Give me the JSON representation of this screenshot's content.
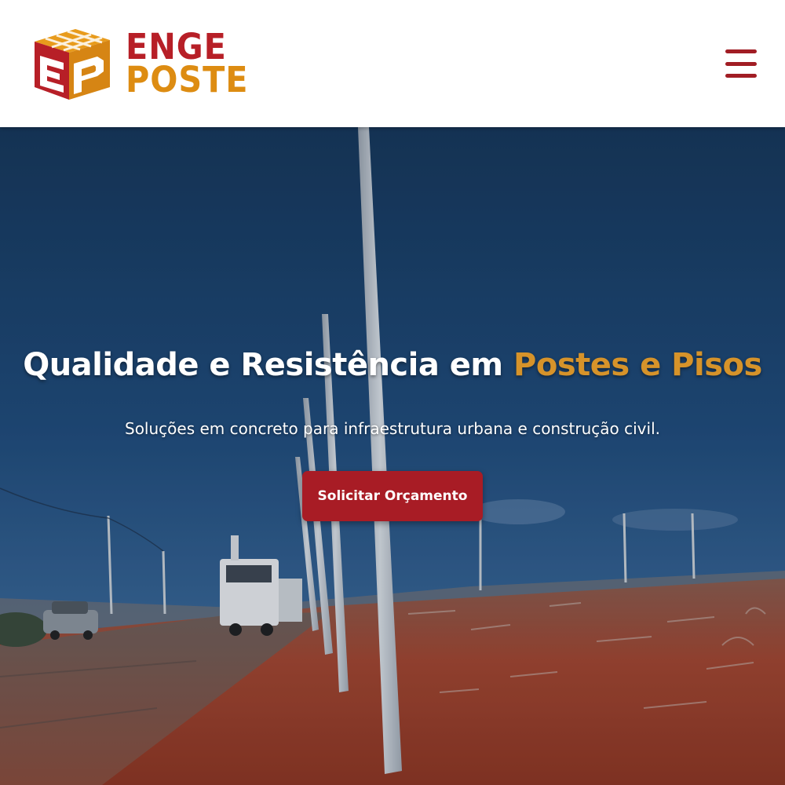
{
  "header": {
    "logo": {
      "line1": "ENGE",
      "line2": "POSTE",
      "monogram": "EP"
    },
    "menu_icon": "hamburger-menu-icon"
  },
  "hero": {
    "title_main": "Qualidade e Resistência em ",
    "title_accent": "Postes e Pisos",
    "subtitle": "Soluções em concreto para infraestrutura urbana e construção civil.",
    "cta_label": "Solicitar Orçamento"
  },
  "colors": {
    "brand_red": "#a81c25",
    "brand_orange": "#dd8c12",
    "accent_gold": "#d6932a",
    "header_bg": "#ffffff"
  }
}
